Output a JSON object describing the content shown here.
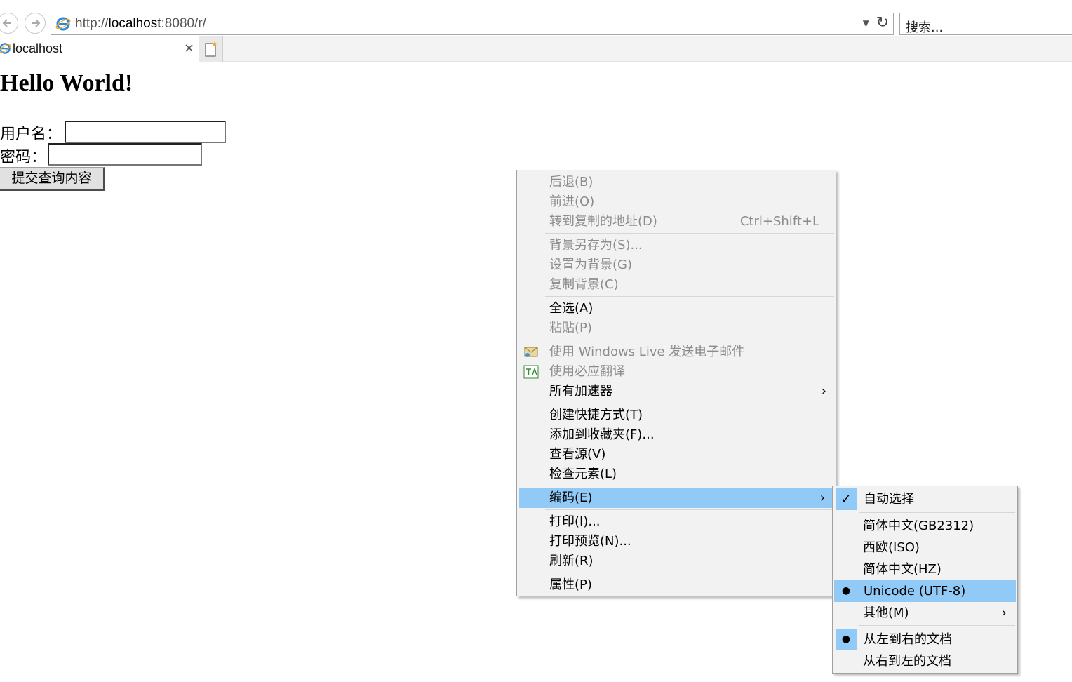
{
  "browser": {
    "url_prefix": "http://",
    "url_host": "localhost",
    "url_rest": ":8080/r/",
    "search_placeholder": "搜索...",
    "tab_title": "localhost",
    "tab_close": "×"
  },
  "page": {
    "heading": "Hello World!",
    "username_label": "用户名：",
    "password_label": "密码：",
    "submit_label": "提交查询内容"
  },
  "context_menu": {
    "items": [
      {
        "label": "后退(B)",
        "enabled": false
      },
      {
        "label": "前进(O)",
        "enabled": false
      },
      {
        "label": "转到复制的地址(D)",
        "shortcut": "Ctrl+Shift+L",
        "enabled": false
      },
      {
        "label": "背景另存为(S)...",
        "enabled": false
      },
      {
        "label": "设置为背景(G)",
        "enabled": false
      },
      {
        "label": "复制背景(C)",
        "enabled": false
      },
      {
        "label": "全选(A)",
        "enabled": true
      },
      {
        "label": "粘贴(P)",
        "enabled": false
      },
      {
        "label": "使用 Windows Live 发送电子邮件",
        "enabled": false,
        "icon": "email-icon"
      },
      {
        "label": "使用必应翻译",
        "enabled": false,
        "icon": "translate-icon"
      },
      {
        "label": "所有加速器",
        "enabled": true,
        "submenu": true
      },
      {
        "label": "创建快捷方式(T)",
        "enabled": true
      },
      {
        "label": "添加到收藏夹(F)...",
        "enabled": true
      },
      {
        "label": "查看源(V)",
        "enabled": true
      },
      {
        "label": "检查元素(L)",
        "enabled": true
      },
      {
        "label": "编码(E)",
        "enabled": true,
        "submenu": true,
        "highlighted": true
      },
      {
        "label": "打印(I)...",
        "enabled": true
      },
      {
        "label": "打印预览(N)...",
        "enabled": true
      },
      {
        "label": "刷新(R)",
        "enabled": true
      },
      {
        "label": "属性(P)",
        "enabled": true
      }
    ],
    "arrow": "›"
  },
  "encoding_submenu": {
    "items": [
      {
        "label": "自动选择",
        "mark": "check"
      },
      {
        "label": "简体中文(GB2312)",
        "mark": ""
      },
      {
        "label": "西欧(ISO)",
        "mark": ""
      },
      {
        "label": "简体中文(HZ)",
        "mark": ""
      },
      {
        "label": "Unicode (UTF-8)",
        "mark": "dot",
        "highlighted": true
      },
      {
        "label": "其他(M)",
        "mark": "",
        "submenu": true
      },
      {
        "label": "从左到右的文档",
        "mark": "dot"
      },
      {
        "label": "从右到左的文档",
        "mark": ""
      }
    ],
    "check_glyph": "✓",
    "dot_glyph": "●"
  },
  "colors": {
    "menu_bg": "#f2f2f2",
    "highlight": "#91c9f7",
    "disabled_text": "#8c8c8c"
  }
}
